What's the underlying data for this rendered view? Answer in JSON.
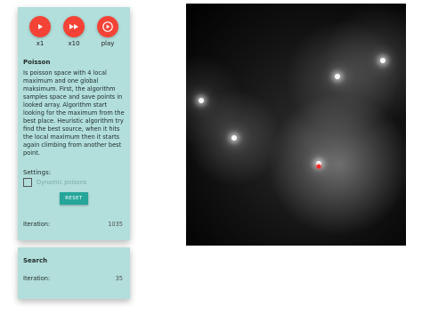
{
  "controls": [
    {
      "label": "x1",
      "icon": "play-icon"
    },
    {
      "label": "x10",
      "icon": "fast-forward-icon"
    },
    {
      "label": "play",
      "icon": "play-circle-icon"
    }
  ],
  "main": {
    "title": "Poisson",
    "description": "Is poisson space with 4 local maximum and one global maksimum. First, the algorithm samples space and save points in looked array. Algorithm start looking for the maximum from the best place. Heuristic algorithm try find the best source, when it hits the local maximum then it starts again climbing from another best point.",
    "settings_label": "Settings:",
    "dynamic_checkbox_label": "Dynamic poisons",
    "dynamic_checked": false,
    "reset_label": "RESET",
    "iteration_label": "Iteration:",
    "iteration_value": "1035"
  },
  "search": {
    "title": "Search",
    "iteration_label": "Iteration:",
    "iteration_value": "35"
  },
  "colors": {
    "panel_bg": "#b2dfdb",
    "accent_red": "#f44336",
    "button_teal": "#26a69a",
    "marker_red": "#ff2020"
  }
}
